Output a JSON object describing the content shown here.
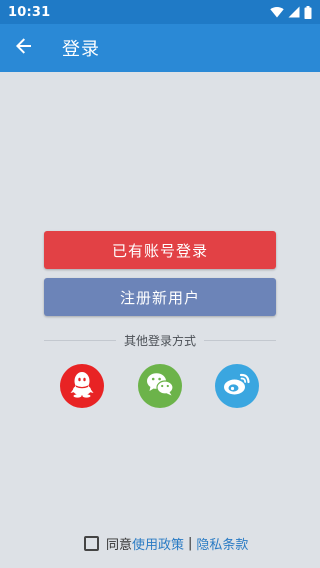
{
  "status_bar": {
    "time": "10:31",
    "icons": [
      "wifi-icon",
      "signal-icon",
      "battery-icon"
    ]
  },
  "app_bar": {
    "back_icon": "arrow-left-icon",
    "title": "登录"
  },
  "buttons": {
    "login_label": "已有账号登录",
    "register_label": "注册新用户"
  },
  "other_login": {
    "label": "其他登录方式",
    "providers": [
      {
        "name": "qq",
        "icon": "qq-icon",
        "color": "#e82324"
      },
      {
        "name": "wechat",
        "icon": "wechat-icon",
        "color": "#6cb34a"
      },
      {
        "name": "weibo",
        "icon": "weibo-icon",
        "color": "#3aa6e0"
      }
    ]
  },
  "agreement": {
    "checked": false,
    "prefix": "同意",
    "policy_link": "使用政策",
    "separator": "|",
    "privacy_link": "隐私条款"
  },
  "colors": {
    "status_bar": "#1f7ac6",
    "app_bar": "#2a89d6",
    "background": "#dde1e6",
    "login_button": "#e24145",
    "register_button": "#6c84b8",
    "link": "#2a7bc4"
  }
}
